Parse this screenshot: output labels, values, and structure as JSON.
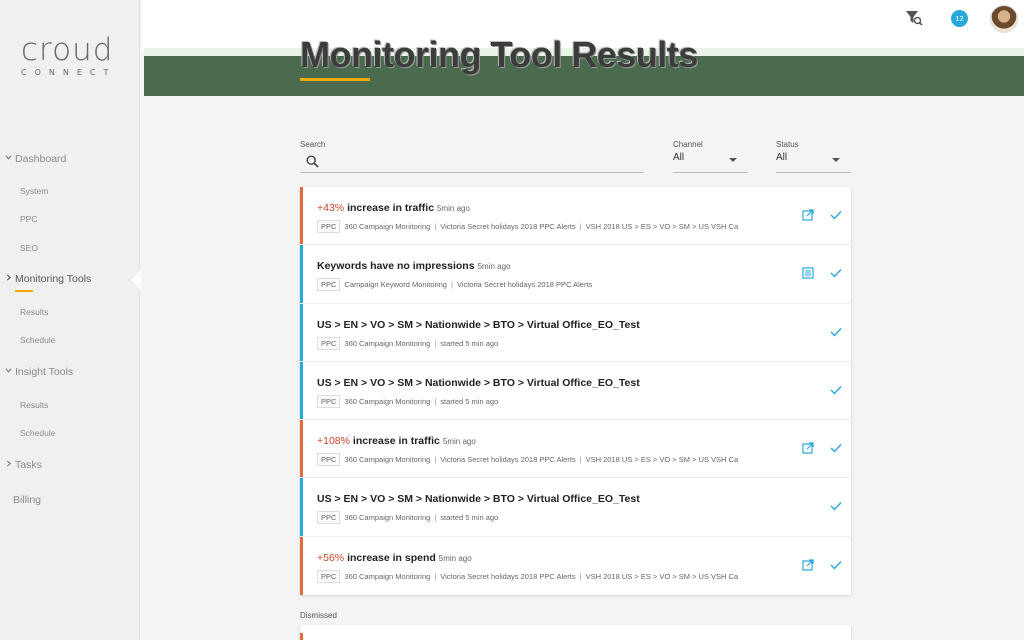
{
  "brand": {
    "logo_word": "croud",
    "logo_sub": "CONNECT"
  },
  "header": {
    "title": "Monitoring Tool Results",
    "notification_count": "12"
  },
  "sidebar": {
    "items": [
      {
        "label": "Dashboard",
        "type": "main"
      },
      {
        "label": "System",
        "type": "sub"
      },
      {
        "label": "PPC",
        "type": "sub"
      },
      {
        "label": "SEO",
        "type": "sub"
      },
      {
        "label": "Monitoring Tools",
        "type": "main"
      },
      {
        "label": "Results",
        "type": "sub"
      },
      {
        "label": "Schedule",
        "type": "sub"
      },
      {
        "label": "Insight Tools",
        "type": "main"
      },
      {
        "label": "Results",
        "type": "sub"
      },
      {
        "label": "Schedule",
        "type": "sub"
      },
      {
        "label": "Tasks",
        "type": "main"
      },
      {
        "label": "Billing",
        "type": "main"
      }
    ]
  },
  "filters": {
    "search_label": "Search",
    "search_value": "",
    "channel_label": "Channel",
    "channel_value": "All",
    "status_label": "Status",
    "status_value": "All"
  },
  "colors": {
    "accent": "#f5a800",
    "alert": "#e36b3a",
    "info": "#2aa8dc",
    "header_band": "#4a6b4d"
  },
  "results": [
    {
      "kind": "alert",
      "pct": "+43%",
      "title": "increase in traffic",
      "time": "5min ago",
      "tag": "PPC",
      "meta": [
        "360 Campaign Monitoring",
        "Victoria Secret holidays 2018 PPC Alerts",
        "VSH 2018 US > ES > VO > SM > US VSH Ca"
      ],
      "icon": "external-link-icon"
    },
    {
      "kind": "info",
      "pct": "",
      "title": "Keywords have no impressions",
      "time": "5min ago",
      "tag": "PPC",
      "meta": [
        "Campaign Keyword Monitoring",
        "Victoria Secret holidays 2018 PPC Alerts"
      ],
      "icon": "document-icon"
    },
    {
      "kind": "info",
      "pct": "",
      "title": "US > EN > VO > SM > Nationwide > BTO > Virtual Office_EO_Test",
      "time": "",
      "tag": "PPC",
      "meta": [
        "360 Campaign Monitoring",
        "started 5 min ago"
      ],
      "icon": ""
    },
    {
      "kind": "info",
      "pct": "",
      "title": "US > EN > VO > SM > Nationwide > BTO > Virtual Office_EO_Test",
      "time": "",
      "tag": "PPC",
      "meta": [
        "360 Campaign Monitoring",
        "started 5 min ago"
      ],
      "icon": ""
    },
    {
      "kind": "alert",
      "pct": "+108%",
      "title": "increase in traffic",
      "time": "5min ago",
      "tag": "PPC",
      "meta": [
        "360 Campaign Monitoring",
        "Victoria Secret holidays 2018 PPC Alerts",
        "VSH 2018 US > ES > VO > SM > US VSH Ca"
      ],
      "icon": "external-link-icon"
    },
    {
      "kind": "info",
      "pct": "",
      "title": "US > EN > VO > SM > Nationwide > BTO > Virtual Office_EO_Test",
      "time": "",
      "tag": "PPC",
      "meta": [
        "360 Campaign Monitoring",
        "started 5 min ago"
      ],
      "icon": ""
    },
    {
      "kind": "alert",
      "pct": "+56%",
      "title": "increase in spend",
      "time": "5min ago",
      "tag": "PPC",
      "meta": [
        "360 Campaign Monitoring",
        "Victoria Secret holidays 2018 PPC Alerts",
        "VSH 2018 US > ES > VO > SM > US VSH Ca"
      ],
      "icon": "external-link-icon"
    }
  ],
  "dismissed": {
    "label": "Dismissed"
  }
}
